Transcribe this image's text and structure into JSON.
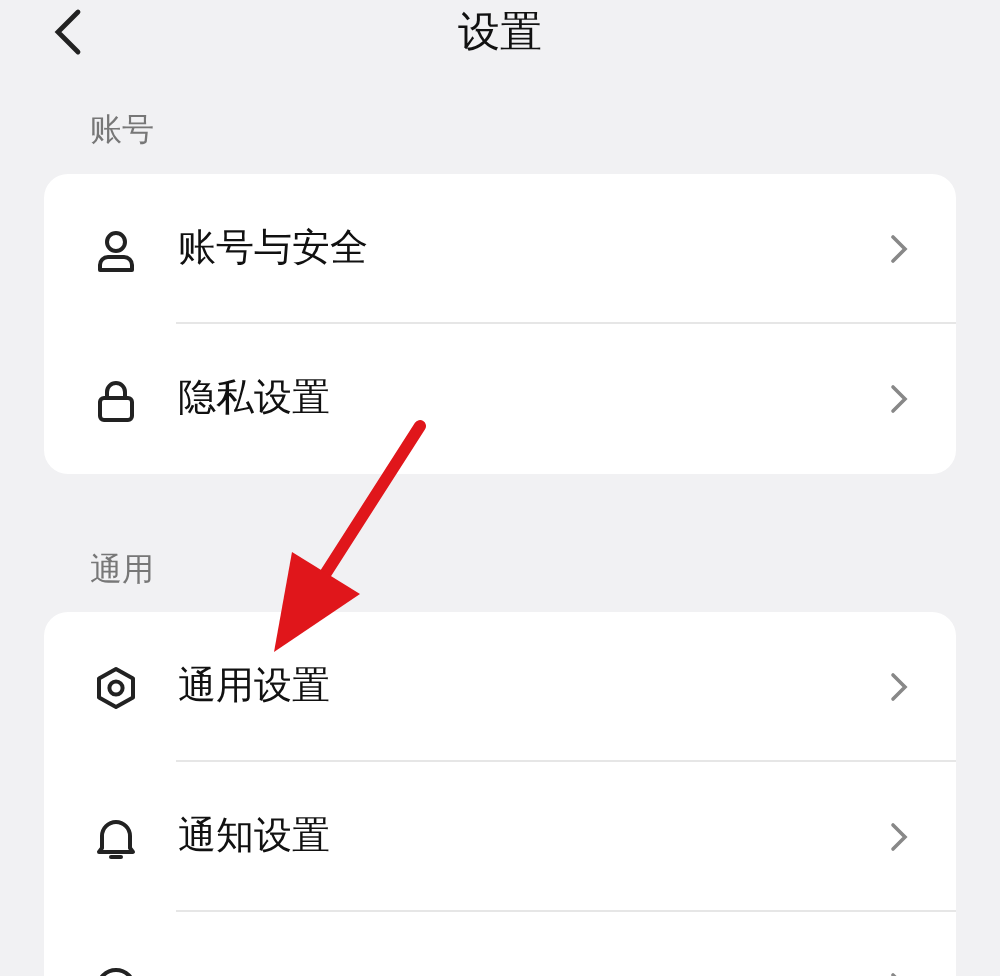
{
  "header": {
    "title": "设置"
  },
  "sections": [
    {
      "label": "账号",
      "items": [
        {
          "kind": "person",
          "label": "账号与安全"
        },
        {
          "kind": "lock",
          "label": "隐私设置"
        }
      ]
    },
    {
      "label": "通用",
      "items": [
        {
          "kind": "gear",
          "label": "通用设置"
        },
        {
          "kind": "bell",
          "label": "通知设置"
        },
        {
          "kind": "circle"
        }
      ]
    }
  ],
  "annotation": {
    "kind": "arrow"
  }
}
